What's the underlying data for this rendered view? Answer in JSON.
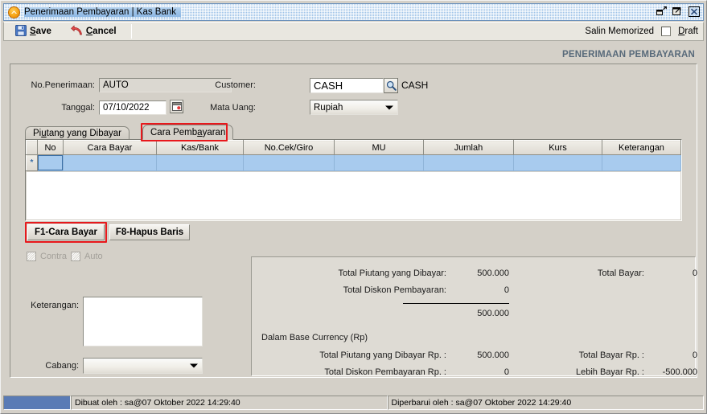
{
  "window": {
    "title": "Penerimaan Pembayaran | Kas Bank",
    "app_icon": "orange-circle-chevron-icon",
    "controls": [
      {
        "name": "restore-button",
        "icon": "restore-icon"
      },
      {
        "name": "maximize-button",
        "icon": "maximize-icon"
      },
      {
        "name": "close-button",
        "icon": "close-icon"
      }
    ]
  },
  "toolbar": {
    "save_label": "Save",
    "save_mnemonic": "S",
    "cancel_label": "Cancel",
    "cancel_mnemonic": "C",
    "memorized_label": "Salin Memorized",
    "draft_label": "Draft",
    "draft_mnemonic": "D",
    "draft_checked": false
  },
  "page_header": "PENERIMAAN PEMBAYARAN",
  "form": {
    "no_penerimaan_label": "No.Penerimaan:",
    "no_penerimaan_value": "AUTO",
    "tanggal_label": "Tanggal:",
    "tanggal_value": "07/10/2022",
    "calendar_icon": "calendar-icon",
    "customer_label": "Customer:",
    "customer_value": "CASH",
    "customer_lookup_icon": "magnifier-icon",
    "customer_name": "CASH",
    "mata_uang_label": "Mata Uang:",
    "mata_uang_value": "Rupiah"
  },
  "tabs": [
    {
      "label": "Piutang yang Dibayar",
      "mnemonic": "u",
      "active": false
    },
    {
      "label": "Cara Pembayaran",
      "mnemonic": "a",
      "active": true,
      "highlighted": true
    }
  ],
  "grid": {
    "columns": [
      "No",
      "Cara Bayar",
      "Kas/Bank",
      "No.Cek/Giro",
      "MU",
      "Jumlah",
      "Kurs",
      "Keterangan"
    ],
    "new_row_marker": "*",
    "rows": [
      {
        "No": "",
        "Cara Bayar": "",
        "Kas/Bank": "",
        "No.Cek/Giro": "",
        "MU": "",
        "Jumlah": "",
        "Kurs": "",
        "Keterangan": ""
      }
    ]
  },
  "grid_buttons": [
    {
      "label": "F1-Cara Bayar",
      "highlighted": true
    },
    {
      "label": "F8-Hapus Baris",
      "highlighted": false
    }
  ],
  "options": {
    "contra_label": "Contra",
    "contra_checked": false,
    "contra_disabled": true,
    "auto_label": "Auto",
    "auto_checked": false,
    "auto_disabled": true
  },
  "notes": {
    "keterangan_label": "Keterangan:",
    "keterangan_value": "",
    "cabang_label": "Cabang:",
    "cabang_value": ""
  },
  "totals": {
    "base_currency_label": "Dalam Base Currency (Rp)",
    "left_rows": [
      {
        "label": "Total Piutang yang Dibayar:",
        "value": "500.000"
      },
      {
        "label": "Total Diskon Pembayaran:",
        "value": "0"
      }
    ],
    "subtotal_value": "500.000",
    "right_rows": [
      {
        "label": "Total Bayar:",
        "value": "0"
      }
    ],
    "base_left_rows": [
      {
        "label": "Total Piutang yang Dibayar Rp. :",
        "value": "500.000"
      },
      {
        "label": "Total Diskon Pembayaran Rp. :",
        "value": "0"
      }
    ],
    "base_right_rows": [
      {
        "label": "Total Bayar Rp. :",
        "value": "0"
      },
      {
        "label": "Lebih Bayar Rp. :",
        "value": "-500.000"
      }
    ]
  },
  "statusbar": {
    "created": "Dibuat oleh : sa@07 Oktober 2022  14:29:40",
    "updated": "Diperbarui oleh : sa@07 Oktober 2022  14:29:40"
  },
  "colors": {
    "titlebar": "#9ec3e8",
    "window_bg": "#d4d0c8",
    "grid_row_selected": "#a8cbee",
    "highlight_red": "#e8181c",
    "header_text": "#586a7a",
    "status_accent": "#5a7bb5"
  }
}
